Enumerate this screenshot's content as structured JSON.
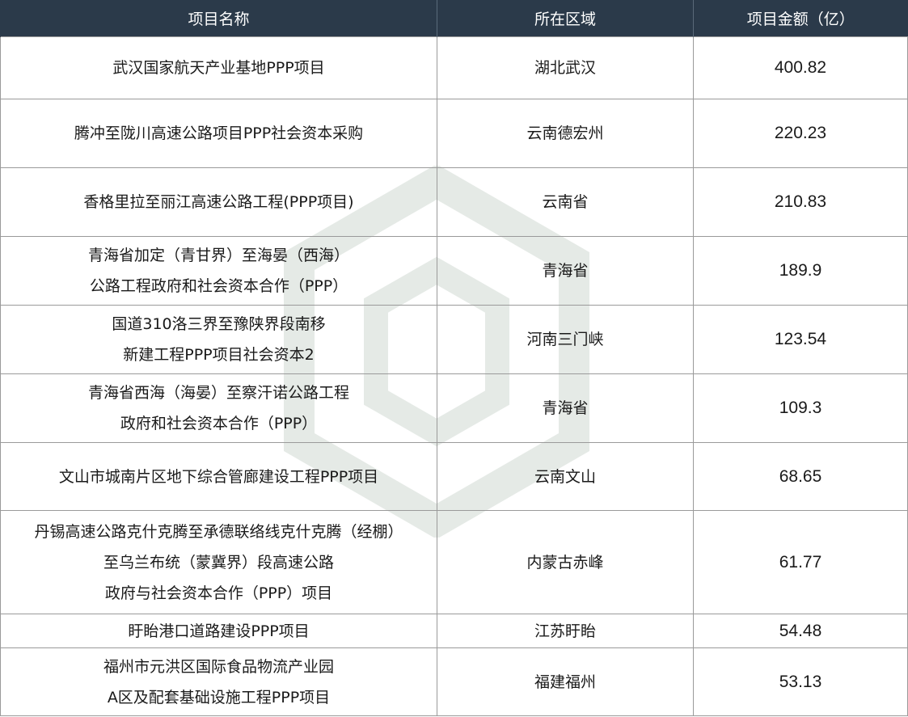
{
  "headers": [
    "项目名称",
    "所在区域",
    "项目金额（亿）"
  ],
  "rows": [
    {
      "name": [
        "武汉国家航天产业基地PPP项目"
      ],
      "region": "湖北武汉",
      "amount": "400.82"
    },
    {
      "name": [
        "腾冲至陇川高速公路项目PPP社会资本采购"
      ],
      "region": "云南德宏州",
      "amount": "220.23"
    },
    {
      "name": [
        "香格里拉至丽江高速公路工程(PPP项目)"
      ],
      "region": "云南省",
      "amount": "210.83"
    },
    {
      "name": [
        "青海省加定（青甘界）至海晏（西海）",
        "公路工程政府和社会资本合作（PPP）"
      ],
      "region": "青海省",
      "amount": "189.9"
    },
    {
      "name": [
        "国道310洛三界至豫陕界段南移",
        "新建工程PPP项目社会资本2"
      ],
      "region": "河南三门峡",
      "amount": "123.54"
    },
    {
      "name": [
        "青海省西海（海晏）至察汗诺公路工程",
        "政府和社会资本合作（PPP）"
      ],
      "region": "青海省",
      "amount": "109.3"
    },
    {
      "name": [
        "文山市城南片区地下综合管廊建设工程PPP项目"
      ],
      "region": "云南文山",
      "amount": "68.65"
    },
    {
      "name": [
        "丹锡高速公路克什克腾至承德联络线克什克腾（经棚）",
        "至乌兰布统（蒙冀界）段高速公路",
        "政府与社会资本合作（PPP）项目"
      ],
      "region": "内蒙古赤峰",
      "amount": "61.77"
    },
    {
      "name": [
        "盱眙港口道路建设PPP项目"
      ],
      "region": "江苏盱眙",
      "amount": "54.48"
    },
    {
      "name": [
        "福州市元洪区国际食品物流产业园",
        "A区及配套基础设施工程PPP项目"
      ],
      "region": "福建福州",
      "amount": "53.13"
    }
  ]
}
